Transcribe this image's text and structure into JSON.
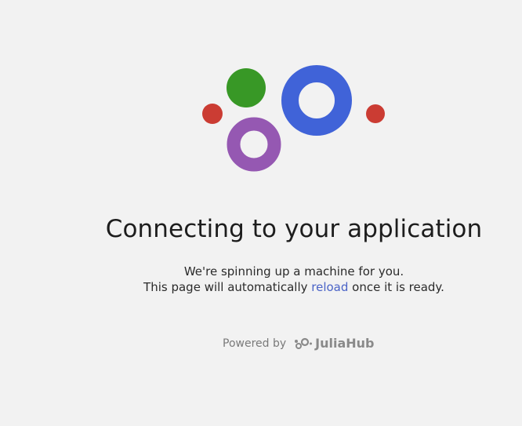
{
  "heading": "Connecting to your application",
  "message": {
    "line1": "We're spinning up a machine for you.",
    "line2_before": "This page will automatically ",
    "reload_link": "reload",
    "line2_after": " once it is ready."
  },
  "footer": {
    "powered_by": "Powered by",
    "brand_name": "JuliaHub"
  },
  "colors": {
    "julia_green": "#389826",
    "julia_red": "#cb3c33",
    "julia_purple": "#9558b2",
    "ring_blue": "#4063d8",
    "link": "#4a63c7",
    "background": "#f2f2f2"
  },
  "icons": {
    "logo": "julia-dots-logo",
    "brand": "juliahub-logo-icon"
  }
}
